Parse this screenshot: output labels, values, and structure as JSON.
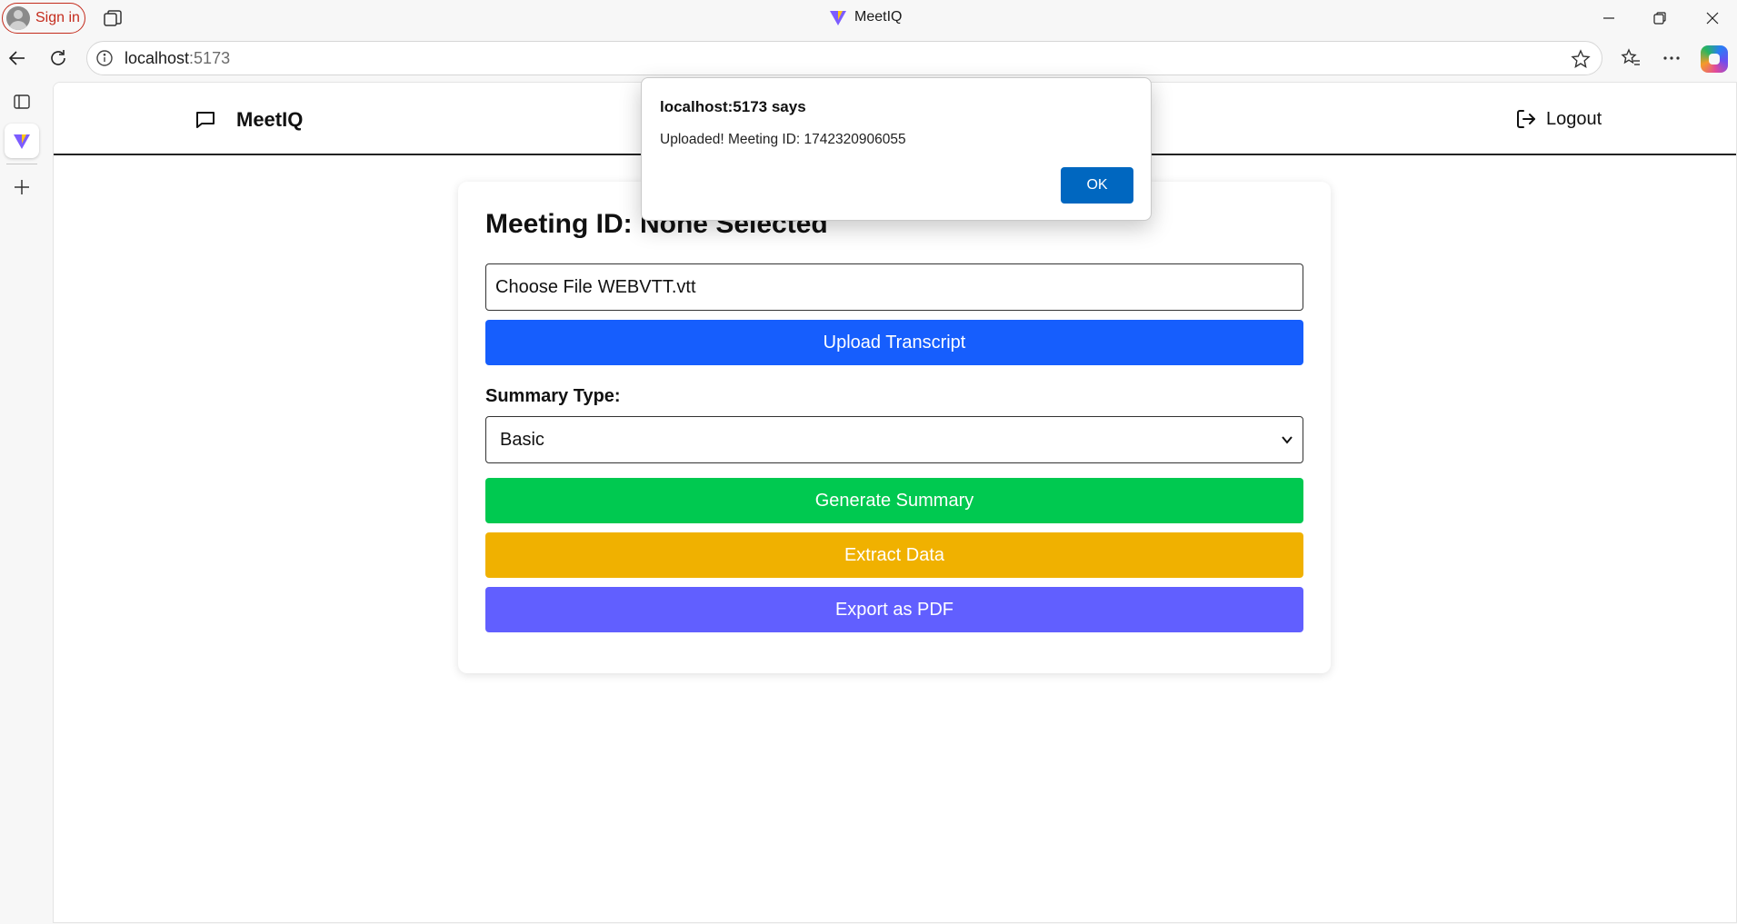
{
  "browser": {
    "window_title": "MeetIQ",
    "sign_in_label": "Sign in",
    "address": {
      "host": "localhost",
      "port": ":5173"
    },
    "icons": [
      "profile-icon",
      "tab-actions-icon",
      "vite-logo-icon",
      "minimize-icon",
      "restore-icon",
      "close-icon",
      "back-icon",
      "refresh-icon",
      "site-info-icon",
      "favorite-star-icon",
      "favorites-icon",
      "more-icon",
      "copilot-icon",
      "sidebar-panel-icon",
      "new-tab-plus-icon"
    ]
  },
  "app": {
    "brand": "MeetIQ",
    "logout_label": "Logout",
    "meeting_heading": "Meeting ID: None Selected",
    "file_input": {
      "button": "Choose File",
      "filename": "WEBVTT.vtt"
    },
    "upload_button": "Upload Transcript",
    "summary_type_label": "Summary Type:",
    "summary_type_value": "Basic",
    "generate_button": "Generate Summary",
    "extract_button": "Extract Data",
    "export_button": "Export as PDF",
    "colors": {
      "upload": "#165efd",
      "generate": "#00c950",
      "extract": "#f0b100",
      "export": "#615fff"
    }
  },
  "dialog": {
    "title": "localhost:5173 says",
    "message": "Uploaded! Meeting ID: 1742320906055",
    "ok_label": "OK"
  }
}
